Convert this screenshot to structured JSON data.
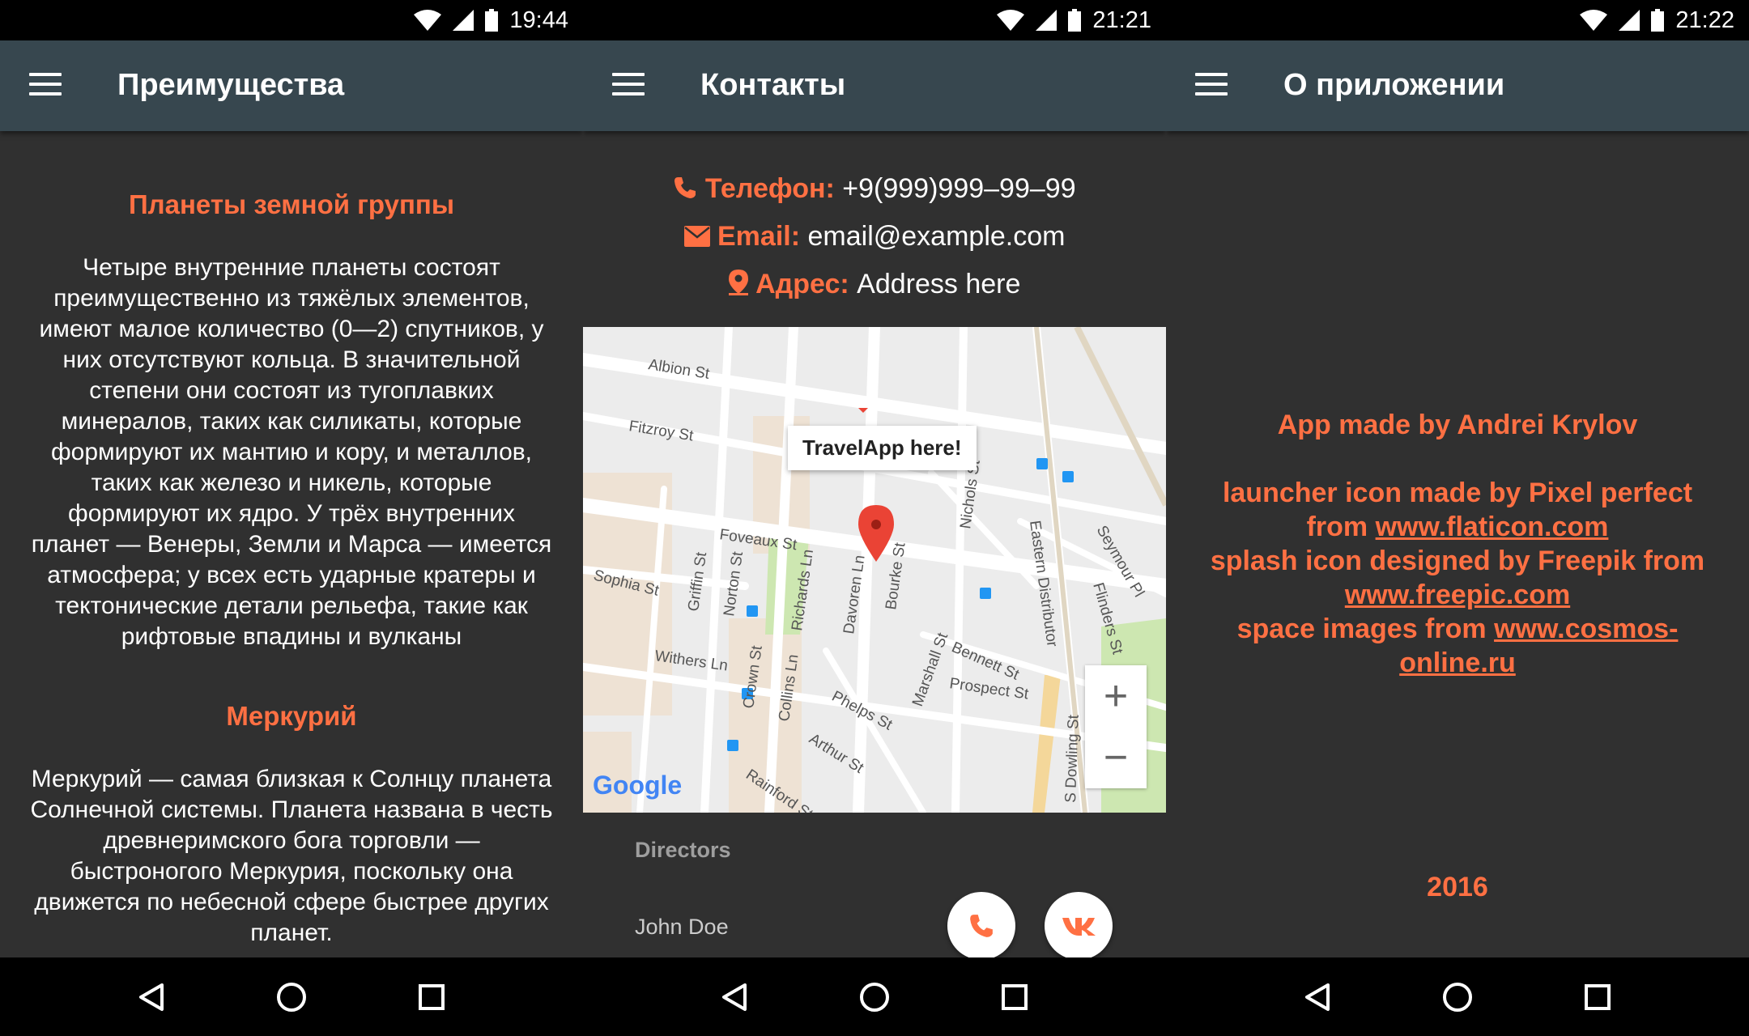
{
  "screens": [
    {
      "time": "19:44",
      "title": "Преимущества"
    },
    {
      "time": "21:21",
      "title": "Контакты"
    },
    {
      "time": "21:22",
      "title": "О приложении"
    }
  ],
  "benefits": {
    "section1_title": "Планеты земной группы",
    "section1_text": "Четыре внутренние планеты состоят преимущественно из тяжёлых элементов, имеют малое количество (0—2) спутников, у них отсутствуют кольца. В значительной степени они состоят из тугоплавких минералов, таких как силикаты, которые формируют их мантию и кору, и металлов, таких как железо и никель, которые формируют их ядро. У трёх внутренних планет — Венеры, Земли и Марса — имеется атмосфера; у всех есть ударные кратеры и тектонические детали рельефа, такие как рифтовые впадины и вулканы",
    "section2_title": "Меркурий",
    "section2_text": "Меркурий — самая близкая к Солнцу планета Солнечной системы. Планета названа в честь древнеримского бога торговли — быстроногого Меркурия, поскольку она движется по небесной сфере быстрее других планет."
  },
  "contacts": {
    "phone_label": "Телефон:",
    "phone_value": "+9(999)999–99–99",
    "email_label": "Email:",
    "email_value": "email@example.com",
    "address_label": "Адрес:",
    "address_value": "Address here",
    "map": {
      "info_window": "TravelApp here!",
      "logo": "Google",
      "zoom_in": "+",
      "zoom_out": "−",
      "streets": {
        "albion": "Albion St",
        "fitzroy": "Fitzroy St",
        "foveaux": "Foveaux St",
        "sophia": "Sophia St",
        "griffin": "Griffin St",
        "norton": "Norton St",
        "richards": "Richards Ln",
        "withers": "Withers Ln",
        "crown": "Crown St",
        "collins": "Collins Ln",
        "davoren": "Davoren Ln",
        "bourke": "Bourke St",
        "nichols": "Nichols St",
        "eastern": "Eastern Distributor",
        "seymour": "Seymour Pl",
        "flinders": "Flinders St",
        "marshall": "Marshall St",
        "bennett": "Bennett St",
        "prospect": "Prospect St",
        "phelps": "Phelps St",
        "arthur": "Arthur St",
        "rainford": "Rainford St",
        "dowling": "S Dowling St"
      }
    },
    "directors_header": "Directors",
    "director_name": "John Doe"
  },
  "about": {
    "made_by": "App made by Andrei Krylov",
    "launcher_text": "launcher icon made by Pixel perfect from ",
    "launcher_link": "www.flaticon.com",
    "splash_text": "splash icon designed by Freepik from ",
    "splash_link": "www.freepic.com",
    "space_text": "space images from ",
    "space_link": "www.cosmos-online.ru",
    "year": "2016"
  },
  "colors": {
    "accent": "#ff7043",
    "appbar": "#37474f",
    "background": "#303030"
  }
}
